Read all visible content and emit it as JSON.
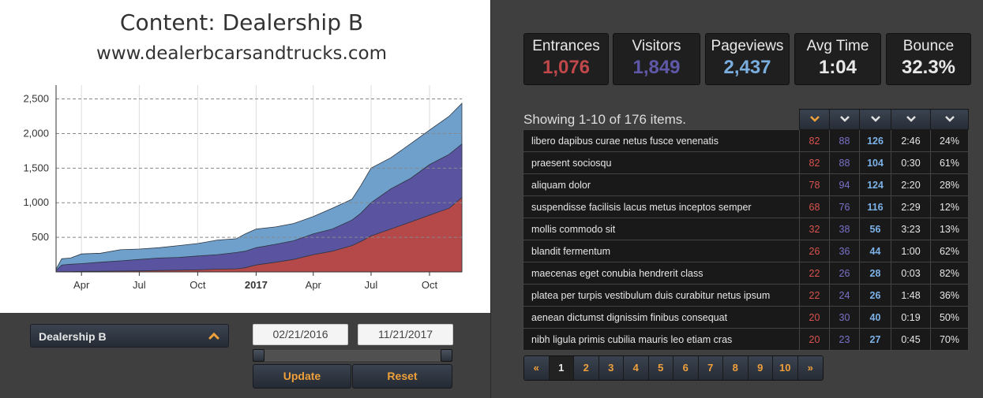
{
  "chart": {
    "title": "Content: Dealership B",
    "subtitle": "www.dealerbcarsandtrucks.com"
  },
  "colors": {
    "pageviews": "#6fa0cb",
    "visitors": "#5a54a0",
    "entrances": "#b54848",
    "accent": "#f0a03a"
  },
  "chart_data": {
    "type": "area",
    "stacked": false,
    "title": "Content: Dealership B",
    "subtitle": "www.dealerbcarsandtrucks.com",
    "xlabel": "",
    "ylabel": "",
    "ylim": [
      0,
      2500
    ],
    "yticks": [
      500,
      1000,
      1500,
      2000,
      2500
    ],
    "grid": true,
    "x_tick_labels": [
      "Apr",
      "Jul",
      "Oct",
      "2017",
      "Apr",
      "Jul",
      "Oct"
    ],
    "x_tick_dates": [
      "2016-04-01",
      "2016-07-01",
      "2016-10-01",
      "2017-01-01",
      "2017-04-01",
      "2017-07-01",
      "2017-10-01"
    ],
    "x": [
      "2016-02-21",
      "2016-03-01",
      "2016-03-15",
      "2016-04-01",
      "2016-05-01",
      "2016-06-01",
      "2016-07-01",
      "2016-08-01",
      "2016-09-01",
      "2016-10-01",
      "2016-11-01",
      "2016-12-01",
      "2016-12-15",
      "2017-01-01",
      "2017-02-01",
      "2017-03-01",
      "2017-04-01",
      "2017-05-01",
      "2017-06-01",
      "2017-06-15",
      "2017-07-01",
      "2017-08-01",
      "2017-09-01",
      "2017-10-01",
      "2017-11-01",
      "2017-11-21"
    ],
    "series": [
      {
        "name": "Pageviews",
        "values": [
          40,
          190,
          200,
          260,
          270,
          320,
          330,
          350,
          380,
          410,
          460,
          480,
          550,
          620,
          650,
          700,
          800,
          920,
          1050,
          1250,
          1500,
          1650,
          1850,
          2050,
          2250,
          2437
        ]
      },
      {
        "name": "Visitors",
        "values": [
          20,
          100,
          110,
          120,
          140,
          160,
          180,
          200,
          210,
          230,
          250,
          280,
          300,
          350,
          400,
          450,
          550,
          620,
          750,
          850,
          1000,
          1200,
          1350,
          1550,
          1700,
          1849
        ]
      },
      {
        "name": "Entrances",
        "values": [
          0,
          5,
          5,
          8,
          10,
          12,
          15,
          20,
          25,
          30,
          40,
          45,
          60,
          100,
          140,
          180,
          250,
          300,
          380,
          440,
          520,
          620,
          720,
          820,
          920,
          1076
        ]
      }
    ]
  },
  "filters": {
    "dealer_label": "Dealership B",
    "start_date": "02/21/2016",
    "end_date": "11/21/2017",
    "update_label": "Update",
    "reset_label": "Reset"
  },
  "stats": [
    {
      "label": "Entrances",
      "value": "1,076",
      "color": "#c0474a"
    },
    {
      "label": "Visitors",
      "value": "1,849",
      "color": "#5f58a8"
    },
    {
      "label": "Pageviews",
      "value": "2,437",
      "color": "#7aaede"
    },
    {
      "label": "Avg Time",
      "value": "1:04",
      "color": "#e8e8e8"
    },
    {
      "label": "Bounce",
      "value": "32.3%",
      "color": "#e8e8e8"
    }
  ],
  "table": {
    "showing_text": "Showing 1-10 of 176 items.",
    "sort_icons": [
      "chevron-down-icon-active",
      "chevron-down-icon",
      "chevron-down-icon",
      "chevron-down-icon",
      "chevron-down-icon"
    ],
    "rows": [
      {
        "name": "libero dapibus curae netus fusce venenatis",
        "entrances": "82",
        "visitors": "88",
        "pageviews": "126",
        "time": "2:46",
        "bounce": "24%"
      },
      {
        "name": "praesent sociosqu",
        "entrances": "82",
        "visitors": "88",
        "pageviews": "104",
        "time": "0:30",
        "bounce": "61%"
      },
      {
        "name": "aliquam dolor",
        "entrances": "78",
        "visitors": "94",
        "pageviews": "124",
        "time": "2:20",
        "bounce": "28%"
      },
      {
        "name": "suspendisse facilisis lacus metus inceptos semper",
        "entrances": "68",
        "visitors": "76",
        "pageviews": "116",
        "time": "2:29",
        "bounce": "12%"
      },
      {
        "name": "mollis commodo sit",
        "entrances": "32",
        "visitors": "38",
        "pageviews": "56",
        "time": "3:23",
        "bounce": "13%"
      },
      {
        "name": "blandit fermentum",
        "entrances": "26",
        "visitors": "36",
        "pageviews": "44",
        "time": "1:00",
        "bounce": "62%"
      },
      {
        "name": "maecenas eget conubia hendrerit class",
        "entrances": "22",
        "visitors": "26",
        "pageviews": "28",
        "time": "0:03",
        "bounce": "82%"
      },
      {
        "name": "platea per turpis vestibulum duis curabitur netus ipsum",
        "entrances": "22",
        "visitors": "24",
        "pageviews": "26",
        "time": "1:48",
        "bounce": "36%"
      },
      {
        "name": "aenean dictumst dignissim finibus consequat",
        "entrances": "20",
        "visitors": "30",
        "pageviews": "40",
        "time": "0:19",
        "bounce": "50%"
      },
      {
        "name": "nibh ligula primis cubilia mauris leo etiam cras",
        "entrances": "20",
        "visitors": "23",
        "pageviews": "27",
        "time": "0:45",
        "bounce": "70%"
      }
    ]
  },
  "pagination": {
    "prev": "«",
    "pages": [
      "1",
      "2",
      "3",
      "4",
      "5",
      "6",
      "7",
      "8",
      "9",
      "10"
    ],
    "next": "»",
    "current": "1"
  }
}
